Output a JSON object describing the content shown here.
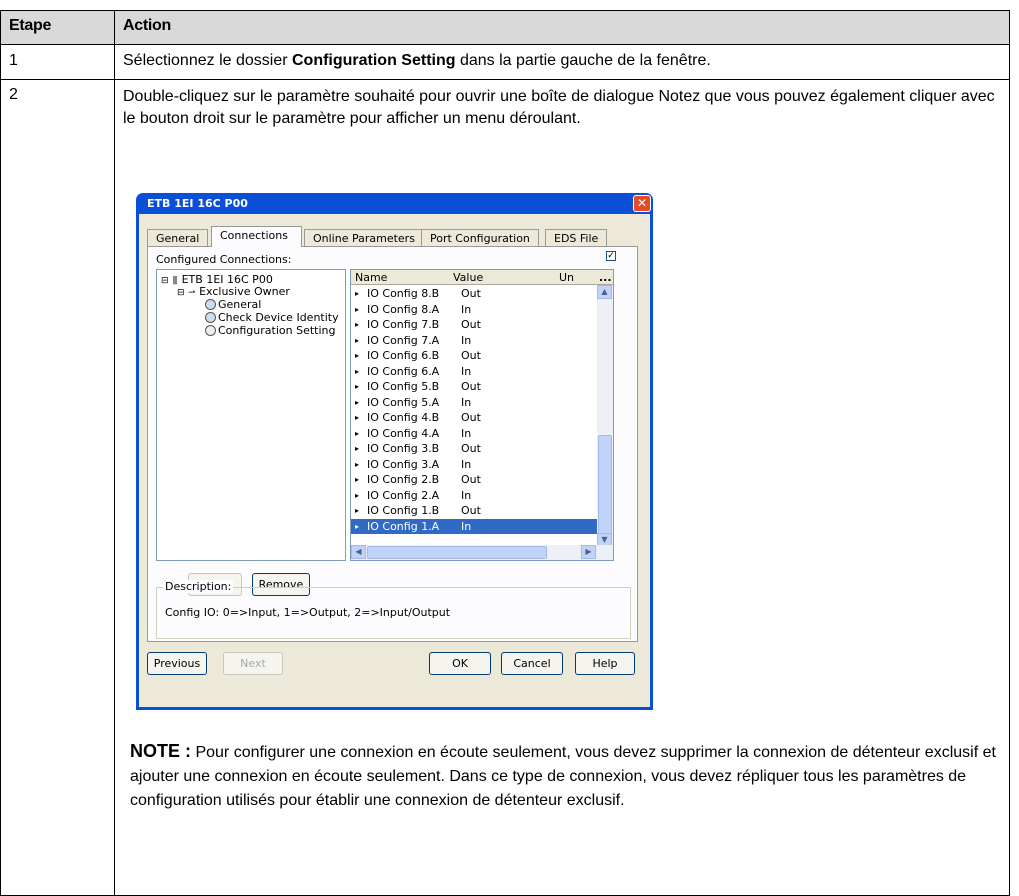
{
  "table": {
    "headers": [
      "Etape",
      "Action"
    ],
    "row1": {
      "step": "1",
      "text_before": "Sélectionnez le dossier ",
      "bold": "Configuration Setting",
      "text_after": " dans la partie gauche de la fenêtre."
    },
    "row2": {
      "step": "2",
      "text": "Double-cliquez sur le paramètre souhaité pour ouvrir une boîte de dialogue Notez que vous pouvez également cliquer avec le bouton droit sur le paramètre pour afficher un menu déroulant."
    }
  },
  "note": {
    "label": "NOTE :",
    "text": " Pour configurer une connexion en écoute seulement, vous devez supprimer la connexion de détenteur exclusif et ajouter une connexion en écoute seulement. Dans ce type de connexion, vous devez répliquer tous les paramètres de configuration utilisés pour établir une connexion de détenteur exclusif."
  },
  "dialog": {
    "title": "ETB 1EI 16C P00",
    "close": "✕",
    "tabs": [
      "General",
      "Connections",
      "Online Parameters",
      "Port Configuration",
      "EDS File"
    ],
    "configured_label": "Configured Connections:",
    "check_mark": "✓",
    "tree": {
      "root": "ETB 1EI 16C P00",
      "owner": "Exclusive Owner",
      "items": [
        "General",
        "Check Device Identity",
        "Configuration Setting"
      ]
    },
    "grid": {
      "headers": [
        "Name",
        "Value",
        "Un"
      ],
      "more": "...",
      "rows": [
        [
          "IO Config 8.B",
          "Out"
        ],
        [
          "IO Config 8.A",
          "In"
        ],
        [
          "IO Config 7.B",
          "Out"
        ],
        [
          "IO Config 7.A",
          "In"
        ],
        [
          "IO Config 6.B",
          "Out"
        ],
        [
          "IO Config 6.A",
          "In"
        ],
        [
          "IO Config 5.B",
          "Out"
        ],
        [
          "IO Config 5.A",
          "In"
        ],
        [
          "IO Config 4.B",
          "Out"
        ],
        [
          "IO Config 4.A",
          "In"
        ],
        [
          "IO Config 3.B",
          "Out"
        ],
        [
          "IO Config 3.A",
          "In"
        ],
        [
          "IO Config 2.B",
          "Out"
        ],
        [
          "IO Config 2.A",
          "In"
        ],
        [
          "IO Config 1.B",
          "Out"
        ],
        [
          "IO Config 1.A",
          "In"
        ]
      ],
      "selected_index": 15
    },
    "buttons": {
      "add": "Add",
      "remove": "Remove",
      "previous": "Previous",
      "next": "Next",
      "ok": "OK",
      "cancel": "Cancel",
      "help": "Help"
    },
    "description": {
      "label": "Description:",
      "text": "Config IO: 0=>Input, 1=>Output, 2=>Input/Output"
    }
  }
}
